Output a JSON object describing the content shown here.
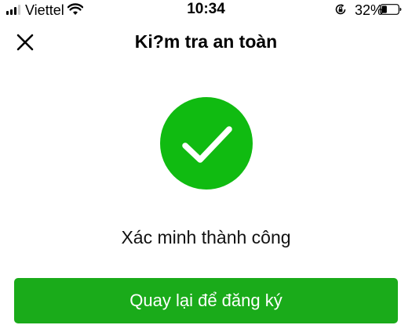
{
  "status_bar": {
    "carrier": "Viettel",
    "time": "10:34",
    "battery_percent": "32%",
    "battery_level": 0.32,
    "signal_bars_filled": 3,
    "signal_bars_total": 4,
    "icons": [
      "signal-icon",
      "wifi-icon",
      "rotation-lock-icon",
      "battery-icon"
    ]
  },
  "header": {
    "title": "Ki?m tra an toàn",
    "close_icon": "close-icon"
  },
  "main": {
    "status_icon": "check-icon",
    "message": "Xác minh thành công",
    "button_label": "Quay lại để đăng ký"
  },
  "colors": {
    "success_green": "#10bb11",
    "button_green": "#1aab1a",
    "background": "#ffffff",
    "text": "#000000"
  }
}
